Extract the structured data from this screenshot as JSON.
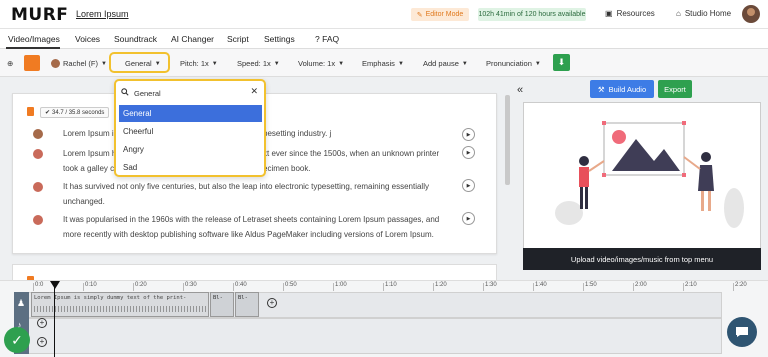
{
  "header": {
    "logo": "MURF",
    "project_title": "Lorem Ipsum",
    "editor_mode": "Editor Mode",
    "time_available": "102h 41min of 120 hours available",
    "resources": "Resources",
    "studio_home": "Studio Home"
  },
  "tabs": [
    "Video/Images",
    "Voices",
    "Soundtrack",
    "AI Changer",
    "Script",
    "Settings",
    "FAQ"
  ],
  "toolbar": {
    "voice": "Rachel (F)",
    "style": "General",
    "pitch": "Pitch: 1x",
    "speed": "Speed: 1x",
    "volume": "Volume: 1x",
    "emphasis": "Emphasis",
    "add_pause": "Add pause",
    "pronunciation": "Pronunciation"
  },
  "script": {
    "duration": "34.7 / 35.8 seconds",
    "rows": [
      {
        "line1": "Lorem Ipsum i",
        "line1_tail": "pesetting industry. j"
      },
      {
        "line1": "Lorem Ipsum h",
        "line1_tail": "xt ever since the 1500s, when an unknown printer",
        "line2": "took a galley c",
        "line2_tail": "ecimen book."
      },
      {
        "line1": "It has survived not only five centuries, but also the leap into electronic typesetting, remaining essentially",
        "line2": "unchanged."
      },
      {
        "line1": "It was popularised in the 1960s with the release of Letraset sheets containing Lorem Ipsum passages, and",
        "line2": "more recently with desktop publishing software like Aldus PageMaker including versions of Lorem Ipsum."
      }
    ]
  },
  "style_dropdown": {
    "search_value": "General",
    "options": [
      "General",
      "Cheerful",
      "Angry",
      "Sad"
    ],
    "selected": "General"
  },
  "right_panel": {
    "build_audio": "Build Audio",
    "export": "Export",
    "upload_caption": "Upload video/images/music from top menu"
  },
  "timeline": {
    "ticks": [
      "0:0",
      "0:10",
      "0:20",
      "0:30",
      "0:40",
      "0:50",
      "1:00",
      "1:10",
      "1:20",
      "1:30",
      "1:40",
      "1:50",
      "2:00",
      "2:10",
      "2:20"
    ],
    "clip1_text": "Lorem Ipsum is simply dummy text of the print-",
    "clip2_text": "Bl-",
    "clip3_text": "Bl-"
  },
  "colors": {
    "accent_blue": "#3d7ce6",
    "accent_green": "#2ea04f",
    "accent_orange": "#f07b22",
    "highlight_yellow": "#f2c12e"
  }
}
